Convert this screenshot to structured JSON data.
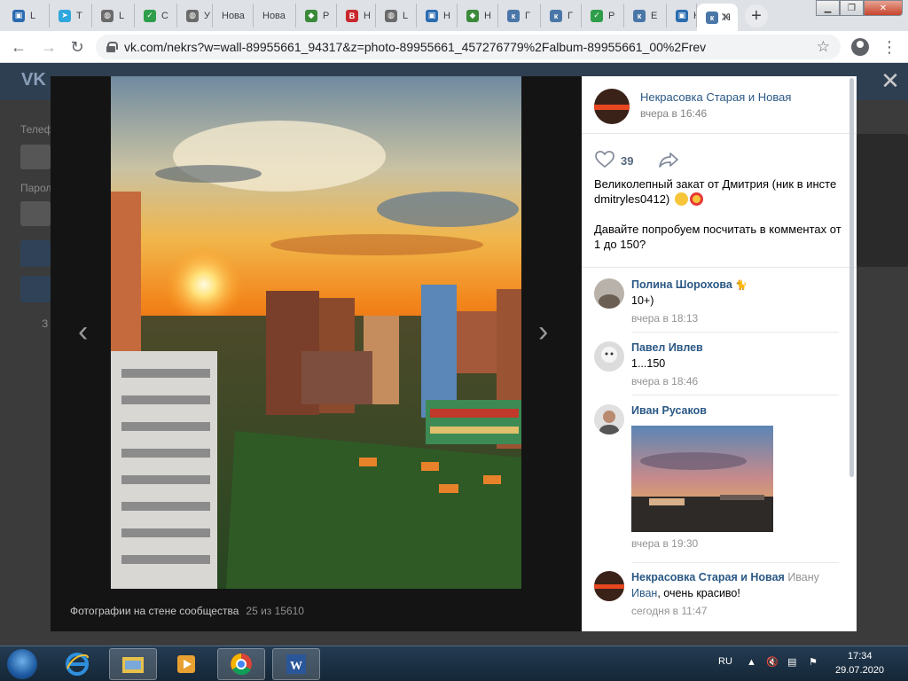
{
  "browser": {
    "tabs": [
      {
        "label": "L",
        "color": "#2b6cb0",
        "glyph": "▣"
      },
      {
        "label": "Т",
        "color": "#2ea6de",
        "glyph": "➤"
      },
      {
        "label": "L",
        "color": "#6b6b6b",
        "glyph": "◍"
      },
      {
        "label": "С",
        "color": "#2e9e4a",
        "glyph": "✓"
      },
      {
        "label": "У",
        "color": "#6b6b6b",
        "glyph": "◍"
      },
      {
        "label": "Нова",
        "color": "",
        "glyph": ""
      },
      {
        "label": "Нова",
        "color": "",
        "glyph": ""
      },
      {
        "label": "Р",
        "color": "#3a8a3a",
        "glyph": "◆"
      },
      {
        "label": "Н",
        "color": "#c8282d",
        "glyph": "В"
      },
      {
        "label": "L",
        "color": "#6b6b6b",
        "glyph": "◍"
      },
      {
        "label": "Н",
        "color": "#2b6cb0",
        "glyph": "▣"
      },
      {
        "label": "Н",
        "color": "#3a8a3a",
        "glyph": "◆"
      },
      {
        "label": "Г",
        "color": "#4a76a8",
        "glyph": "к"
      },
      {
        "label": "Г",
        "color": "#4a76a8",
        "glyph": "к"
      },
      {
        "label": "Р",
        "color": "#2e9e4a",
        "glyph": "✓"
      },
      {
        "label": "Е",
        "color": "#4a76a8",
        "glyph": "к"
      },
      {
        "label": "Н",
        "color": "#2b6cb0",
        "glyph": "▣"
      }
    ],
    "active_tab": {
      "label": "Н",
      "color": "#4a76a8",
      "glyph": "к"
    },
    "url": "vk.com/nekrs?w=wall-89955661_94317&z=photo-89955661_457276779%2Falbum-89955661_00%2Frev"
  },
  "background_page": {
    "logo": "VK",
    "phone_label": "Телеф",
    "password_label": "Парол",
    "misc_label": "З"
  },
  "viewer": {
    "caption": "Фотографии на стене сообщества",
    "counter": "25 из 15610"
  },
  "post": {
    "author": "Некрасовка Старая и Новая",
    "time": "вчера в 16:46",
    "likes": "39",
    "text1": "Великолепный закат от Дмитрия (ник в инсте dmitryles0412)",
    "text2": "Давайте попробуем посчитать в комментах от 1 до 150?"
  },
  "comments": [
    {
      "name": "Полина Шорохова",
      "text": "10+)",
      "time": "вчера в 18:13"
    },
    {
      "name": "Павел Ивлев",
      "text": "1...150",
      "time": "вчера в 18:46"
    },
    {
      "name": "Иван Русаков",
      "text": "",
      "time": "вчера в 19:30"
    },
    {
      "name": "Некрасовка Старая и Новая",
      "reply_to": "Ивану",
      "reply_link": "Иван",
      "text": ", очень красиво!",
      "time": "сегодня в 11:47"
    }
  ],
  "taskbar": {
    "lang": "RU",
    "time": "17:34",
    "date": "29.07.2020"
  }
}
